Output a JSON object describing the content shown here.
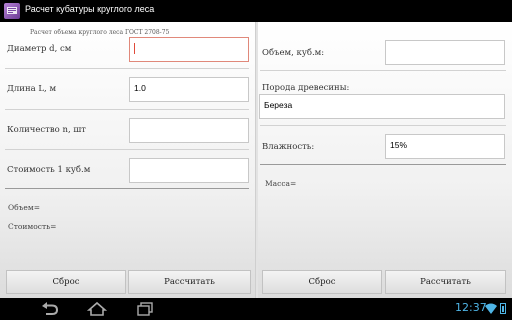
{
  "app": {
    "title": "Расчет кубатуры круглого леса"
  },
  "subtitle": "Расчет объема круглого леса ГОСТ 2708-75",
  "left": {
    "diameter": {
      "label": "Диаметр d, см",
      "value": ""
    },
    "length": {
      "label": "Длина L, м",
      "value": "1.0"
    },
    "count": {
      "label": "Количество n, шт",
      "value": ""
    },
    "cost": {
      "label": "Стоимость 1 куб.м",
      "value": ""
    },
    "volume_result": "Объем=",
    "cost_result": "Стоимость=",
    "reset_button": "Сброс",
    "calc_button": "Рассчитать"
  },
  "right": {
    "volume": {
      "label": "Объем, куб.м:",
      "value": ""
    },
    "wood": {
      "label": "Порода древесины:",
      "value": "Береза"
    },
    "humidity": {
      "label": "Влажность:",
      "value": "15%"
    },
    "mass_result": "Масса=",
    "reset_button": "Сброс",
    "calc_button": "Рассчитать"
  },
  "status": {
    "time": "12:37"
  },
  "icons": {
    "app": "app-icon",
    "back": "back-icon",
    "home": "home-icon",
    "recent": "recent-apps-icon",
    "wifi": "wifi-icon",
    "battery": "battery-icon"
  }
}
